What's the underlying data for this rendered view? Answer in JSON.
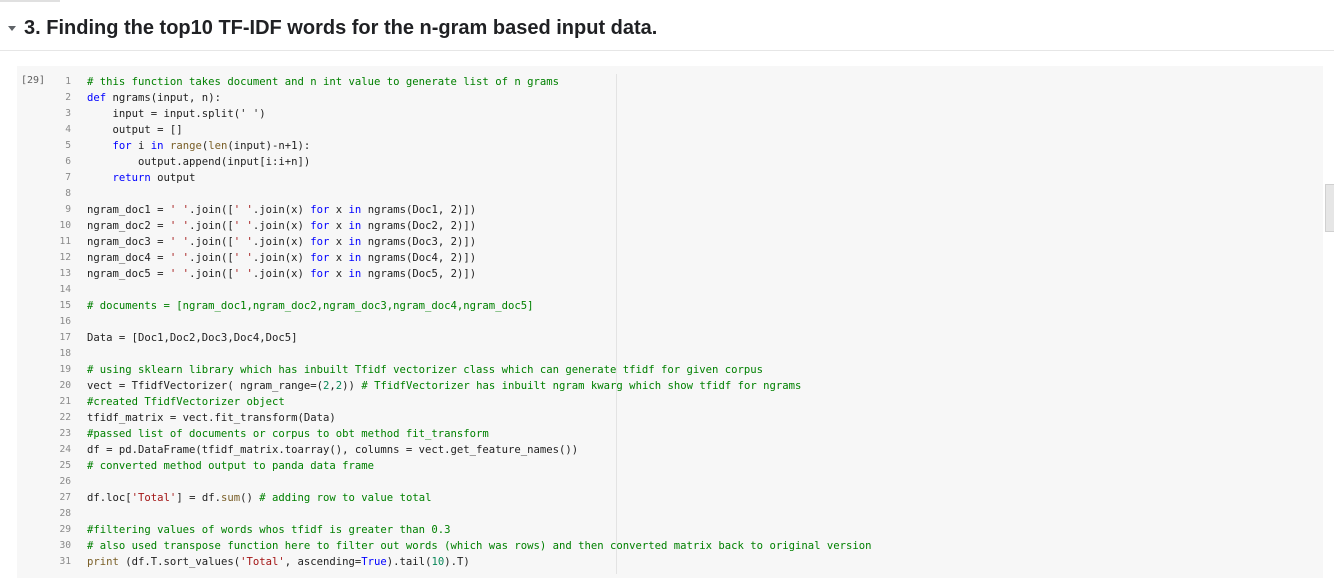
{
  "section": {
    "title": "3. Finding the top10 TF-IDF words for the n-gram based input data."
  },
  "cell": {
    "execution_count": "[29]",
    "lines": [
      {
        "n": "1",
        "tokens": [
          {
            "t": "# this function takes document and n int value to generate list of n grams",
            "c": "t-c"
          }
        ]
      },
      {
        "n": "2",
        "tokens": [
          {
            "t": "def",
            "c": "t-k"
          },
          {
            "t": " ngrams(input, n):",
            "c": ""
          }
        ]
      },
      {
        "n": "3",
        "tokens": [
          {
            "t": "    input = input.split(' ')",
            "c": ""
          }
        ]
      },
      {
        "n": "4",
        "tokens": [
          {
            "t": "    output = []",
            "c": ""
          }
        ]
      },
      {
        "n": "5",
        "tokens": [
          {
            "t": "    ",
            "c": ""
          },
          {
            "t": "for",
            "c": "t-k"
          },
          {
            "t": " i ",
            "c": ""
          },
          {
            "t": "in",
            "c": "t-k"
          },
          {
            "t": " ",
            "c": ""
          },
          {
            "t": "range",
            "c": "t-f"
          },
          {
            "t": "(",
            "c": ""
          },
          {
            "t": "len",
            "c": "t-f"
          },
          {
            "t": "(input)-n+1):",
            "c": ""
          }
        ]
      },
      {
        "n": "6",
        "tokens": [
          {
            "t": "        output.append(input[i:i+n])",
            "c": ""
          }
        ]
      },
      {
        "n": "7",
        "tokens": [
          {
            "t": "    ",
            "c": ""
          },
          {
            "t": "return",
            "c": "t-k"
          },
          {
            "t": " output",
            "c": ""
          }
        ]
      },
      {
        "n": "8",
        "tokens": []
      },
      {
        "n": "9",
        "tokens": [
          {
            "t": "ngram_doc1 = ",
            "c": ""
          },
          {
            "t": "' '",
            "c": "t-s"
          },
          {
            "t": ".join([",
            "c": ""
          },
          {
            "t": "' '",
            "c": "t-s"
          },
          {
            "t": ".join(x) ",
            "c": ""
          },
          {
            "t": "for",
            "c": "t-k"
          },
          {
            "t": " x ",
            "c": ""
          },
          {
            "t": "in",
            "c": "t-k"
          },
          {
            "t": " ngrams(Doc1, 2)])",
            "c": ""
          }
        ]
      },
      {
        "n": "10",
        "tokens": [
          {
            "t": "ngram_doc2 = ",
            "c": ""
          },
          {
            "t": "' '",
            "c": "t-s"
          },
          {
            "t": ".join([",
            "c": ""
          },
          {
            "t": "' '",
            "c": "t-s"
          },
          {
            "t": ".join(x) ",
            "c": ""
          },
          {
            "t": "for",
            "c": "t-k"
          },
          {
            "t": " x ",
            "c": ""
          },
          {
            "t": "in",
            "c": "t-k"
          },
          {
            "t": " ngrams(Doc2, 2)])",
            "c": ""
          }
        ]
      },
      {
        "n": "11",
        "tokens": [
          {
            "t": "ngram_doc3 = ",
            "c": ""
          },
          {
            "t": "' '",
            "c": "t-s"
          },
          {
            "t": ".join([",
            "c": ""
          },
          {
            "t": "' '",
            "c": "t-s"
          },
          {
            "t": ".join(x) ",
            "c": ""
          },
          {
            "t": "for",
            "c": "t-k"
          },
          {
            "t": " x ",
            "c": ""
          },
          {
            "t": "in",
            "c": "t-k"
          },
          {
            "t": " ngrams(Doc3, 2)])",
            "c": ""
          }
        ]
      },
      {
        "n": "12",
        "tokens": [
          {
            "t": "ngram_doc4 = ",
            "c": ""
          },
          {
            "t": "' '",
            "c": "t-s"
          },
          {
            "t": ".join([",
            "c": ""
          },
          {
            "t": "' '",
            "c": "t-s"
          },
          {
            "t": ".join(x) ",
            "c": ""
          },
          {
            "t": "for",
            "c": "t-k"
          },
          {
            "t": " x ",
            "c": ""
          },
          {
            "t": "in",
            "c": "t-k"
          },
          {
            "t": " ngrams(Doc4, 2)])",
            "c": ""
          }
        ]
      },
      {
        "n": "13",
        "tokens": [
          {
            "t": "ngram_doc5 = ",
            "c": ""
          },
          {
            "t": "' '",
            "c": "t-s"
          },
          {
            "t": ".join([",
            "c": ""
          },
          {
            "t": "' '",
            "c": "t-s"
          },
          {
            "t": ".join(x) ",
            "c": ""
          },
          {
            "t": "for",
            "c": "t-k"
          },
          {
            "t": " x ",
            "c": ""
          },
          {
            "t": "in",
            "c": "t-k"
          },
          {
            "t": " ngrams(Doc5, 2)])",
            "c": ""
          }
        ]
      },
      {
        "n": "14",
        "tokens": []
      },
      {
        "n": "15",
        "tokens": [
          {
            "t": "# documents = [ngram_doc1,ngram_doc2,ngram_doc3,ngram_doc4,ngram_doc5]",
            "c": "t-c"
          }
        ]
      },
      {
        "n": "16",
        "tokens": []
      },
      {
        "n": "17",
        "tokens": [
          {
            "t": "Data = [Doc1,Doc2,Doc3,Doc4,Doc5]",
            "c": ""
          }
        ]
      },
      {
        "n": "18",
        "tokens": []
      },
      {
        "n": "19",
        "tokens": [
          {
            "t": "# using sklearn library which has inbuilt Tfidf vectorizer class which can generate tfidf for given corpus",
            "c": "t-c"
          }
        ]
      },
      {
        "n": "20",
        "tokens": [
          {
            "t": "vect = TfidfVectorizer( ngram_range=(",
            "c": ""
          },
          {
            "t": "2",
            "c": "t-n"
          },
          {
            "t": ",",
            "c": ""
          },
          {
            "t": "2",
            "c": "t-n"
          },
          {
            "t": ")) ",
            "c": ""
          },
          {
            "t": "# TfidfVectorizer has inbuilt ngram kwarg which show tfidf for ngrams",
            "c": "t-c"
          }
        ]
      },
      {
        "n": "21",
        "tokens": [
          {
            "t": "#created TfidfVectorizer object",
            "c": "t-c"
          }
        ]
      },
      {
        "n": "22",
        "tokens": [
          {
            "t": "tfidf_matrix = vect.fit_transform(Data)",
            "c": ""
          }
        ]
      },
      {
        "n": "23",
        "tokens": [
          {
            "t": "#passed list of documents or corpus to obt method fit_transform",
            "c": "t-c"
          }
        ]
      },
      {
        "n": "24",
        "tokens": [
          {
            "t": "df = pd.DataFrame(tfidf_matrix.toarray(), columns = vect.get_feature_names())",
            "c": ""
          }
        ]
      },
      {
        "n": "25",
        "tokens": [
          {
            "t": "# converted method output to panda data frame",
            "c": "t-c"
          }
        ]
      },
      {
        "n": "26",
        "tokens": []
      },
      {
        "n": "27",
        "tokens": [
          {
            "t": "df.loc[",
            "c": ""
          },
          {
            "t": "'Total'",
            "c": "t-s"
          },
          {
            "t": "] = df.",
            "c": ""
          },
          {
            "t": "sum",
            "c": "t-f"
          },
          {
            "t": "() ",
            "c": ""
          },
          {
            "t": "# adding row to value total",
            "c": "t-c"
          }
        ]
      },
      {
        "n": "28",
        "tokens": []
      },
      {
        "n": "29",
        "tokens": [
          {
            "t": "#filtering values of words whos tfidf is greater than 0.3",
            "c": "t-c"
          }
        ]
      },
      {
        "n": "30",
        "tokens": [
          {
            "t": "# also used transpose function here to filter out words (which was rows) and then converted matrix back to original version",
            "c": "t-c"
          }
        ]
      },
      {
        "n": "31",
        "tokens": [
          {
            "t": "print",
            "c": "t-f"
          },
          {
            "t": " (df.T.sort_values(",
            "c": ""
          },
          {
            "t": "'Total'",
            "c": "t-s"
          },
          {
            "t": ", ascending=",
            "c": ""
          },
          {
            "t": "True",
            "c": "t-k"
          },
          {
            "t": ").tail(",
            "c": ""
          },
          {
            "t": "10",
            "c": "t-n"
          },
          {
            "t": ").T)",
            "c": ""
          }
        ]
      }
    ]
  }
}
